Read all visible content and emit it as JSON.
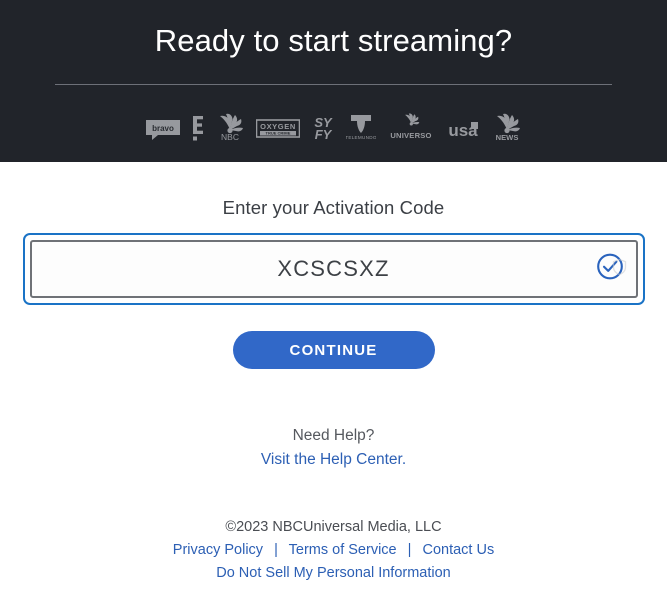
{
  "header": {
    "title": "Ready to start streaming?",
    "background_color": "#21242a",
    "divider_color": "#6d7078",
    "logos": [
      {
        "name": "bravo-logo",
        "label": "bravo"
      },
      {
        "name": "e-entertainment-logo",
        "label": "E!"
      },
      {
        "name": "nbc-logo",
        "label": "NBC"
      },
      {
        "name": "oxygen-true-crime-logo",
        "label": "OXYGEN TRUE CRIME"
      },
      {
        "name": "syfy-logo",
        "label": "SYFY"
      },
      {
        "name": "telemundo-logo",
        "label": "TELEMUNDO"
      },
      {
        "name": "universo-logo",
        "label": "UNIVERSO"
      },
      {
        "name": "usa-network-logo",
        "label": "USA"
      },
      {
        "name": "nbc-news-logo",
        "label": "NBC NEWS"
      }
    ]
  },
  "activation": {
    "label": "Enter your Activation Code",
    "code_value": "XCSCSXZ",
    "code_placeholder": "Enter your Activation Code",
    "valid_icon": "check-circle-icon",
    "secondary_icon": "shield-outline-icon",
    "focus_ring_color": "#1a73c6",
    "field_border_color": "#6f7277"
  },
  "actions": {
    "continue_label": "CONTINUE",
    "continue_color": "#3168c8"
  },
  "help": {
    "title": "Need Help?",
    "link_label": "Visit the Help Center.",
    "link_color": "#2c5fb4"
  },
  "footer": {
    "copyright": "©2023 NBCUniversal Media, LLC",
    "privacy_label": "Privacy Policy",
    "separator_1": "|",
    "terms_label": "Terms of Service",
    "separator_2": "|",
    "contact_label": "Contact Us",
    "do_not_sell_label": "Do Not Sell My Personal Information"
  }
}
